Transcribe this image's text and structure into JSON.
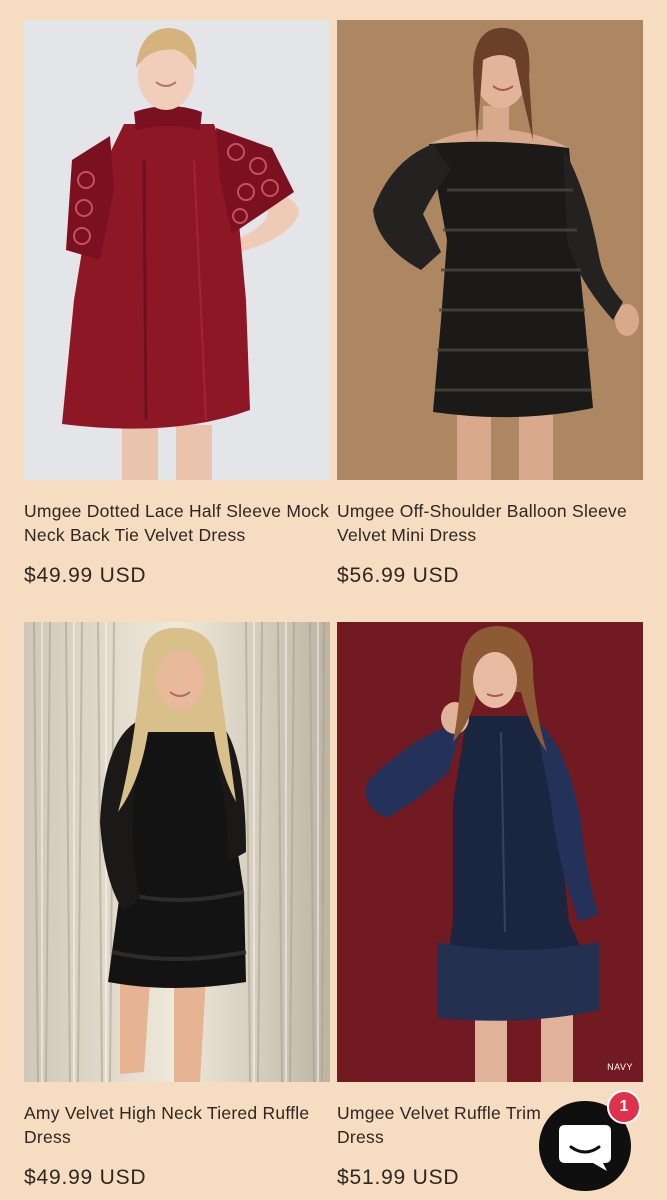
{
  "products": [
    {
      "title": "Umgee Dotted Lace Half Sleeve Mock Neck Back Tie Velvet Dress",
      "price": "$49.99 USD"
    },
    {
      "title": "Umgee Off-Shoulder Balloon Sleeve Velvet Mini Dress",
      "price": "$56.99 USD"
    },
    {
      "title": "Amy Velvet High Neck Tiered Ruffle Dress",
      "price": "$49.99 USD"
    },
    {
      "title": "Umgee Velvet Ruffle Trim Dress",
      "price": "$51.99 USD",
      "image_tag": "NAVY"
    }
  ],
  "chat": {
    "badge_count": "1",
    "icon": "chat-bubble-icon"
  },
  "colors": {
    "page_background": "#f6dcc0",
    "chat_button": "#0f0f0f",
    "badge": "#e0314c"
  }
}
